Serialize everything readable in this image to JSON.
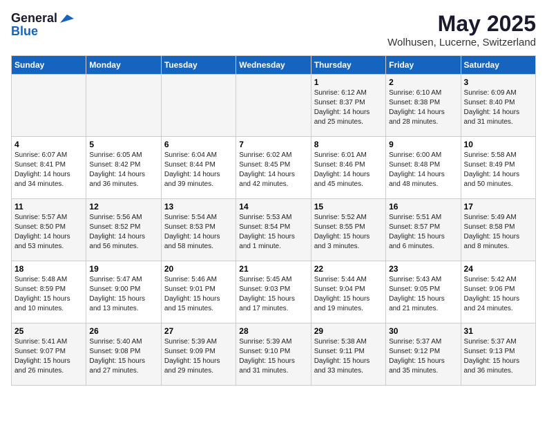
{
  "logo": {
    "line1": "General",
    "line2": "Blue"
  },
  "title": "May 2025",
  "subtitle": "Wolhusen, Lucerne, Switzerland",
  "days_of_week": [
    "Sunday",
    "Monday",
    "Tuesday",
    "Wednesday",
    "Thursday",
    "Friday",
    "Saturday"
  ],
  "weeks": [
    [
      {
        "day": "",
        "info": ""
      },
      {
        "day": "",
        "info": ""
      },
      {
        "day": "",
        "info": ""
      },
      {
        "day": "",
        "info": ""
      },
      {
        "day": "1",
        "info": "Sunrise: 6:12 AM\nSunset: 8:37 PM\nDaylight: 14 hours\nand 25 minutes."
      },
      {
        "day": "2",
        "info": "Sunrise: 6:10 AM\nSunset: 8:38 PM\nDaylight: 14 hours\nand 28 minutes."
      },
      {
        "day": "3",
        "info": "Sunrise: 6:09 AM\nSunset: 8:40 PM\nDaylight: 14 hours\nand 31 minutes."
      }
    ],
    [
      {
        "day": "4",
        "info": "Sunrise: 6:07 AM\nSunset: 8:41 PM\nDaylight: 14 hours\nand 34 minutes."
      },
      {
        "day": "5",
        "info": "Sunrise: 6:05 AM\nSunset: 8:42 PM\nDaylight: 14 hours\nand 36 minutes."
      },
      {
        "day": "6",
        "info": "Sunrise: 6:04 AM\nSunset: 8:44 PM\nDaylight: 14 hours\nand 39 minutes."
      },
      {
        "day": "7",
        "info": "Sunrise: 6:02 AM\nSunset: 8:45 PM\nDaylight: 14 hours\nand 42 minutes."
      },
      {
        "day": "8",
        "info": "Sunrise: 6:01 AM\nSunset: 8:46 PM\nDaylight: 14 hours\nand 45 minutes."
      },
      {
        "day": "9",
        "info": "Sunrise: 6:00 AM\nSunset: 8:48 PM\nDaylight: 14 hours\nand 48 minutes."
      },
      {
        "day": "10",
        "info": "Sunrise: 5:58 AM\nSunset: 8:49 PM\nDaylight: 14 hours\nand 50 minutes."
      }
    ],
    [
      {
        "day": "11",
        "info": "Sunrise: 5:57 AM\nSunset: 8:50 PM\nDaylight: 14 hours\nand 53 minutes."
      },
      {
        "day": "12",
        "info": "Sunrise: 5:56 AM\nSunset: 8:52 PM\nDaylight: 14 hours\nand 56 minutes."
      },
      {
        "day": "13",
        "info": "Sunrise: 5:54 AM\nSunset: 8:53 PM\nDaylight: 14 hours\nand 58 minutes."
      },
      {
        "day": "14",
        "info": "Sunrise: 5:53 AM\nSunset: 8:54 PM\nDaylight: 15 hours\nand 1 minute."
      },
      {
        "day": "15",
        "info": "Sunrise: 5:52 AM\nSunset: 8:55 PM\nDaylight: 15 hours\nand 3 minutes."
      },
      {
        "day": "16",
        "info": "Sunrise: 5:51 AM\nSunset: 8:57 PM\nDaylight: 15 hours\nand 6 minutes."
      },
      {
        "day": "17",
        "info": "Sunrise: 5:49 AM\nSunset: 8:58 PM\nDaylight: 15 hours\nand 8 minutes."
      }
    ],
    [
      {
        "day": "18",
        "info": "Sunrise: 5:48 AM\nSunset: 8:59 PM\nDaylight: 15 hours\nand 10 minutes."
      },
      {
        "day": "19",
        "info": "Sunrise: 5:47 AM\nSunset: 9:00 PM\nDaylight: 15 hours\nand 13 minutes."
      },
      {
        "day": "20",
        "info": "Sunrise: 5:46 AM\nSunset: 9:01 PM\nDaylight: 15 hours\nand 15 minutes."
      },
      {
        "day": "21",
        "info": "Sunrise: 5:45 AM\nSunset: 9:03 PM\nDaylight: 15 hours\nand 17 minutes."
      },
      {
        "day": "22",
        "info": "Sunrise: 5:44 AM\nSunset: 9:04 PM\nDaylight: 15 hours\nand 19 minutes."
      },
      {
        "day": "23",
        "info": "Sunrise: 5:43 AM\nSunset: 9:05 PM\nDaylight: 15 hours\nand 21 minutes."
      },
      {
        "day": "24",
        "info": "Sunrise: 5:42 AM\nSunset: 9:06 PM\nDaylight: 15 hours\nand 24 minutes."
      }
    ],
    [
      {
        "day": "25",
        "info": "Sunrise: 5:41 AM\nSunset: 9:07 PM\nDaylight: 15 hours\nand 26 minutes."
      },
      {
        "day": "26",
        "info": "Sunrise: 5:40 AM\nSunset: 9:08 PM\nDaylight: 15 hours\nand 27 minutes."
      },
      {
        "day": "27",
        "info": "Sunrise: 5:39 AM\nSunset: 9:09 PM\nDaylight: 15 hours\nand 29 minutes."
      },
      {
        "day": "28",
        "info": "Sunrise: 5:39 AM\nSunset: 9:10 PM\nDaylight: 15 hours\nand 31 minutes."
      },
      {
        "day": "29",
        "info": "Sunrise: 5:38 AM\nSunset: 9:11 PM\nDaylight: 15 hours\nand 33 minutes."
      },
      {
        "day": "30",
        "info": "Sunrise: 5:37 AM\nSunset: 9:12 PM\nDaylight: 15 hours\nand 35 minutes."
      },
      {
        "day": "31",
        "info": "Sunrise: 5:37 AM\nSunset: 9:13 PM\nDaylight: 15 hours\nand 36 minutes."
      }
    ]
  ]
}
